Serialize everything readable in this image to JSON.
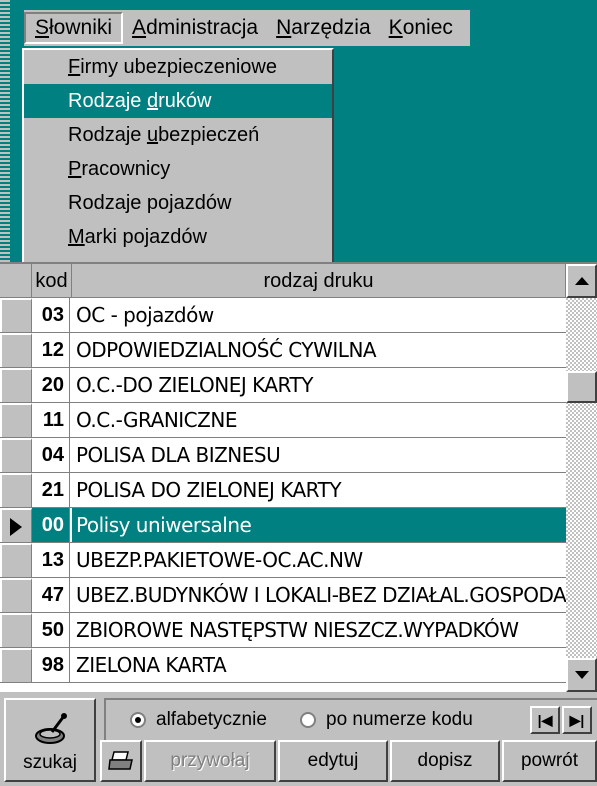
{
  "menubar": {
    "items": [
      {
        "label_pre": "",
        "label_u": "S",
        "label_post": "łowniki"
      },
      {
        "label_pre": "",
        "label_u": "A",
        "label_post": "dministracja"
      },
      {
        "label_pre": "",
        "label_u": "N",
        "label_post": "arzędzia"
      },
      {
        "label_pre": "",
        "label_u": "K",
        "label_post": "oniec"
      }
    ]
  },
  "dropdown": {
    "items": [
      {
        "pre": "",
        "u": "F",
        "post": "irmy ubezpieczeniowe"
      },
      {
        "pre": "Rodzaje ",
        "u": "d",
        "post": "ruków"
      },
      {
        "pre": "Rodzaje ",
        "u": "u",
        "post": "bezpieczeń"
      },
      {
        "pre": "",
        "u": "P",
        "post": "racownicy"
      },
      {
        "pre": "Rodzaje pojazdów",
        "u": "",
        "post": ""
      },
      {
        "pre": "",
        "u": "M",
        "post": "arki pojazdów"
      }
    ],
    "selected_index": 1
  },
  "grid": {
    "columns": {
      "kod": "kod",
      "rodzaj": "rodzaj druku"
    },
    "rows": [
      {
        "kod": "03",
        "name": "OC - pojazdów"
      },
      {
        "kod": "12",
        "name": "ODPOWIEDZIALNOŚĆ CYWILNA"
      },
      {
        "kod": "20",
        "name": "O.C.-DO ZIELONEJ KARTY"
      },
      {
        "kod": "11",
        "name": "O.C.-GRANICZNE"
      },
      {
        "kod": "04",
        "name": "POLISA DLA BIZNESU"
      },
      {
        "kod": "21",
        "name": "POLISA DO ZIELONEJ KARTY"
      },
      {
        "kod": "00",
        "name": "Polisy uniwersalne"
      },
      {
        "kod": "13",
        "name": "UBEZP.PAKIETOWE-OC.AC.NW"
      },
      {
        "kod": "47",
        "name": "UBEZ.BUDYNKÓW I LOKALI-BEZ DZIAŁAL.GOSPODARCZEJ"
      },
      {
        "kod": "50",
        "name": "ZBIOROWE NASTĘPSTW NIESZCZ.WYPADKÓW"
      },
      {
        "kod": "98",
        "name": "ZIELONA KARTA"
      }
    ],
    "active_index": 6
  },
  "bottom": {
    "search_label": "szukaj",
    "radio_alpha": "alfabetycznie",
    "radio_code": "po numerze kodu",
    "nav_first": "|◀",
    "nav_prev": "▶|",
    "buttons": {
      "recall": "przywołaj",
      "edit": "edytuj",
      "add": "dopisz",
      "back": "powrót"
    }
  },
  "colors": {
    "teal": "#008080",
    "face": "#c0c0c0"
  },
  "icons": [
    "search-icon",
    "print-icon",
    "row-pointer-icon",
    "scroll-up-icon",
    "scroll-down-icon"
  ]
}
